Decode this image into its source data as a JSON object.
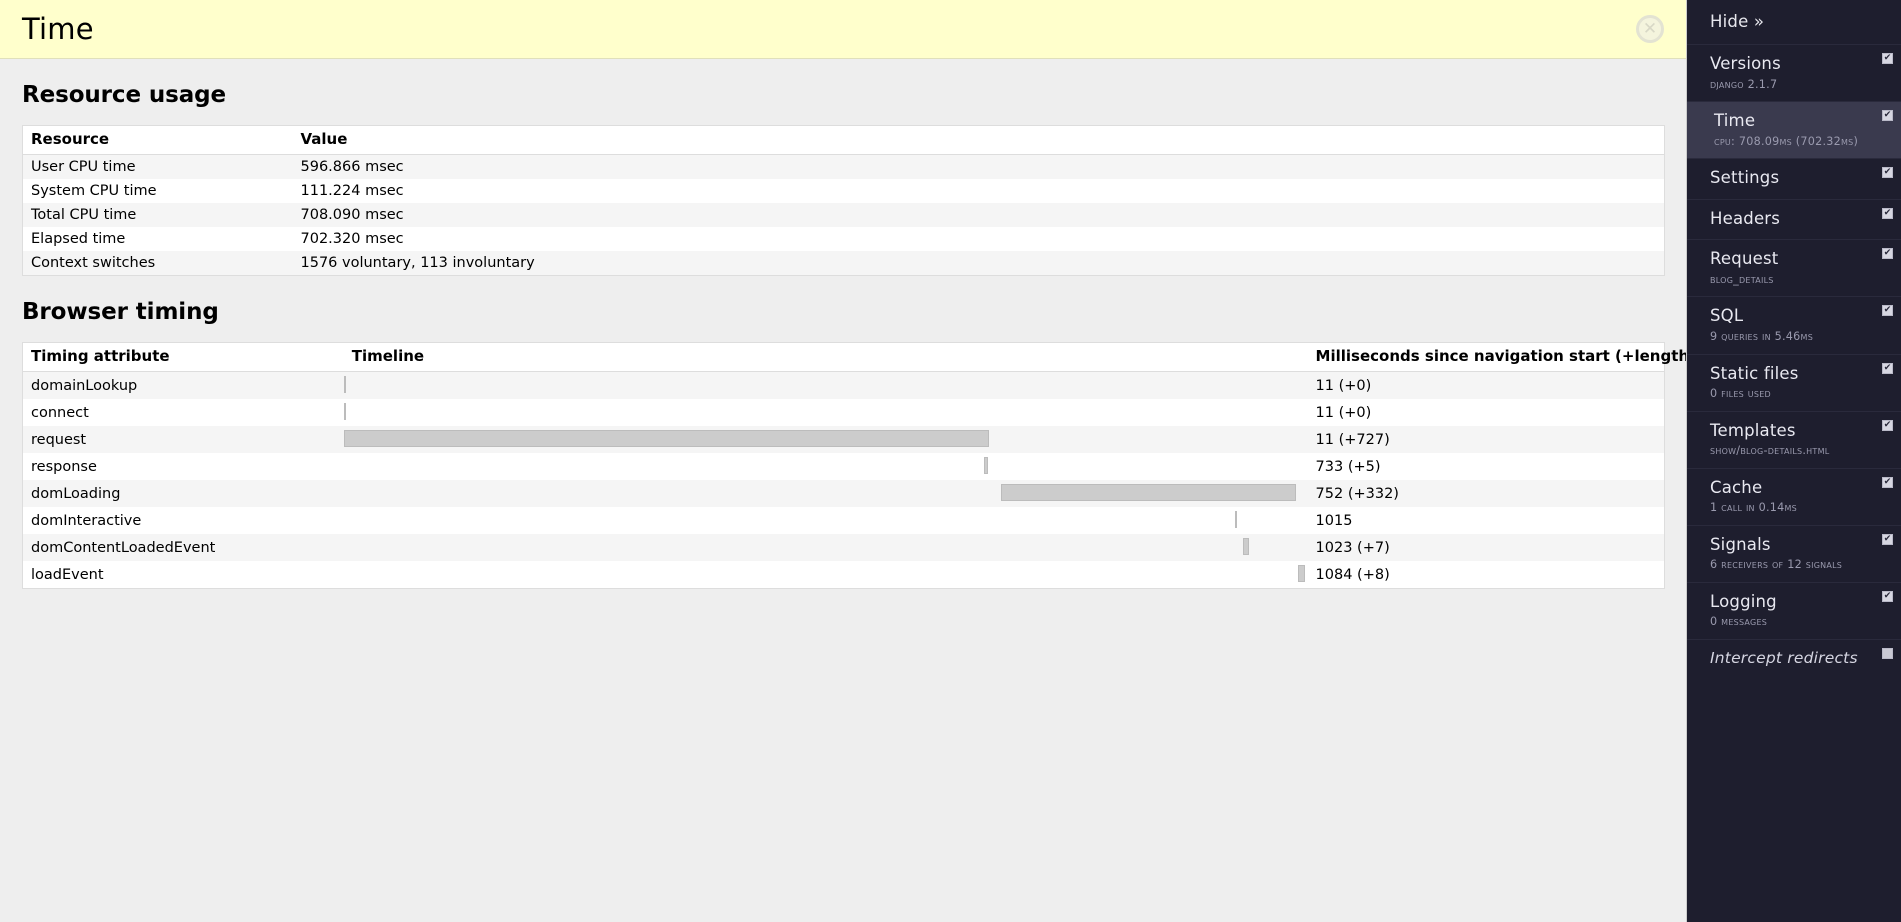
{
  "panel": {
    "title": "Time",
    "close_icon": "close-circle-icon",
    "close_glyph": "✕",
    "sections": {
      "resource_usage": {
        "heading": "Resource usage",
        "columns": [
          "Resource",
          "Value"
        ],
        "rows": [
          [
            "User CPU time",
            "596.866 msec"
          ],
          [
            "System CPU time",
            "111.224 msec"
          ],
          [
            "Total CPU time",
            "708.090 msec"
          ],
          [
            "Elapsed time",
            "702.320 msec"
          ],
          [
            "Context switches",
            "1576 voluntary, 113 involuntary"
          ]
        ]
      },
      "browser_timing": {
        "heading": "Browser timing",
        "columns": [
          "Timing attribute",
          "Timeline",
          "Milliseconds since navigation start (+length)"
        ],
        "rows": [
          {
            "attribute": "domainLookup",
            "ms": "11 (+0)",
            "bar": {
              "left_pct": 0.0,
              "width_pct": 0.18
            }
          },
          {
            "attribute": "connect",
            "ms": "11 (+0)",
            "bar": {
              "left_pct": 0.0,
              "width_pct": 0.18
            }
          },
          {
            "attribute": "request",
            "ms": "11 (+727)",
            "bar": {
              "left_pct": 0.0,
              "width_pct": 66.9
            }
          },
          {
            "attribute": "response",
            "ms": "733 (+5)",
            "bar": {
              "left_pct": 66.4,
              "width_pct": 0.46
            }
          },
          {
            "attribute": "domLoading",
            "ms": "752 (+332)",
            "bar": {
              "left_pct": 68.2,
              "width_pct": 30.6
            }
          },
          {
            "attribute": "domInteractive",
            "ms": "1015",
            "bar": {
              "left_pct": 92.5,
              "width_pct": 0.2
            }
          },
          {
            "attribute": "domContentLoadedEvent",
            "ms": "1023 (+7)",
            "bar": {
              "left_pct": 93.3,
              "width_pct": 0.65
            }
          },
          {
            "attribute": "loadEvent",
            "ms": "1084 (+8)",
            "bar": {
              "left_pct": 99.0,
              "width_pct": 0.74
            }
          }
        ]
      }
    }
  },
  "sidebar": {
    "hide_label": "Hide »",
    "items": [
      {
        "title": "Versions",
        "sub": "Django 2.1.7",
        "checked": true,
        "active": false,
        "italic": false
      },
      {
        "title": "Time",
        "sub": "CPU: 708.09ms (702.32ms)",
        "checked": true,
        "active": true,
        "italic": false
      },
      {
        "title": "Settings",
        "sub": "",
        "checked": true,
        "active": false,
        "italic": false
      },
      {
        "title": "Headers",
        "sub": "",
        "checked": true,
        "active": false,
        "italic": false
      },
      {
        "title": "Request",
        "sub": "blog_details",
        "checked": true,
        "active": false,
        "italic": false
      },
      {
        "title": "SQL",
        "sub": "9 queries in 5.46ms",
        "checked": true,
        "active": false,
        "italic": false
      },
      {
        "title": "Static files",
        "sub": "0 files used",
        "checked": true,
        "active": false,
        "italic": false
      },
      {
        "title": "Templates",
        "sub": "show/blog-details.html",
        "checked": true,
        "active": false,
        "italic": false
      },
      {
        "title": "Cache",
        "sub": "1 call in 0.14ms",
        "checked": true,
        "active": false,
        "italic": false
      },
      {
        "title": "Signals",
        "sub": "6 receivers of 12 signals",
        "checked": true,
        "active": false,
        "italic": false
      },
      {
        "title": "Logging",
        "sub": "0 messages",
        "checked": true,
        "active": false,
        "italic": false
      },
      {
        "title": "Intercept redirects",
        "sub": "",
        "checked": false,
        "active": false,
        "italic": true
      }
    ],
    "check_glyph": "✔"
  },
  "colors": {
    "title_bar": "#ffffcc",
    "sidebar_bg": "#1e1e2e",
    "sidebar_active": "#3a3a4e",
    "bar_fill": "#cccccc",
    "panel_bg": "#eeeeee"
  }
}
